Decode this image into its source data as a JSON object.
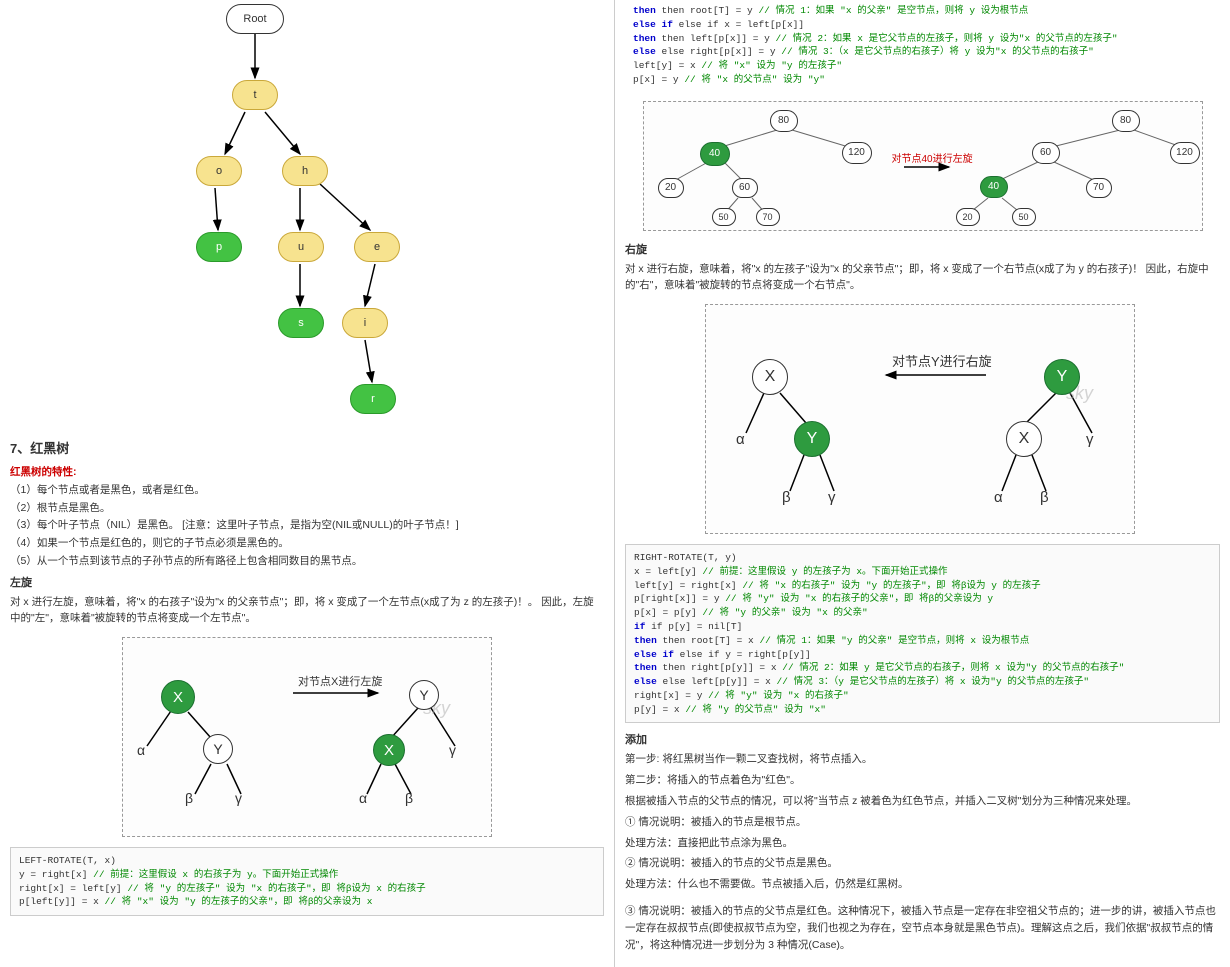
{
  "left": {
    "tree": {
      "nodes": {
        "root": "Root",
        "t": "t",
        "o": "o",
        "h": "h",
        "p": "p",
        "u": "u",
        "e": "e",
        "s": "s",
        "i": "i",
        "r": "r"
      }
    },
    "section_title": "7、红黑树",
    "props_title": "红黑树的特性:",
    "props": [
      "（1）每个节点或者是黑色，或者是红色。",
      "（2）根节点是黑色。",
      "（3）每个叶子节点（NIL）是黑色。 [注意：这里叶子节点，是指为空(NIL或NULL)的叶子节点！]",
      "（4）如果一个节点是红色的，则它的子节点必须是黑色的。",
      "（5）从一个节点到该节点的子孙节点的所有路径上包含相同数目的黑节点。"
    ],
    "left_rotate_title": "左旋",
    "left_rotate_desc": "对 x 进行左旋，意味着，将\"x 的右孩子\"设为\"x 的父亲节点\"；即，将 x 变成了一个左节点(x成了为 z 的左孩子)！。 因此，左旋中的\"左\"，意味着\"被旋转的节点将变成一个左节点\"。",
    "rotate_label": "对节点X进行左旋",
    "nodes": {
      "X": "X",
      "Y": "Y",
      "a": "α",
      "b": "β",
      "c": "γ"
    },
    "code1": {
      "l1": "LEFT-ROTATE(T, x)",
      "l2a": "y = right[x] ",
      "l2b": "// 前提：这里假设 x 的右孩子为 y。下面开始正式操作",
      "l3a": "right[x] = left[y] ",
      "l3b": "// 将 \"y 的左孩子\" 设为 \"x 的右孩子\"，即 将β设为 x 的右孩子",
      "l4a": "p[left[y]] = x ",
      "l4b": "// 将 \"x\" 设为 \"y 的左孩子的父亲\"，即 将β的父亲设为 x"
    }
  },
  "right": {
    "code_top": {
      "l1a": "then root[T] = y ",
      "l1b": "// 情况 1：如果 \"x 的父亲\" 是空节点，则将 y 设为根节点",
      "l2a": "else if x = left[p[x]]",
      "l3a": "then left[p[x]] = y ",
      "l3b": "// 情况 2：如果 x 是它父节点的左孩子，则将 y 设为\"x 的父节点的左孩子\"",
      "l4a": "else right[p[x]] = y ",
      "l4b": "// 情况 3：（x 是它父节点的右孩子）将 y 设为\"x 的父节点的右孩子\"",
      "l5a": "left[y] = x ",
      "l5b": "// 将 \"x\" 设为 \"y 的左孩子\"",
      "l6a": "p[x] = y ",
      "l6b": "// 将 \"x 的父节点\" 设为 \"y\""
    },
    "tree_nums": {
      "n80": "80",
      "n40": "40",
      "n120": "120",
      "n20": "20",
      "n60": "60",
      "n50": "50",
      "n70": "70"
    },
    "rotate40_label": "对节点40进行左旋",
    "right_rotate_title": "右旋",
    "right_rotate_desc": "对 x 进行右旋，意味着，将\"x 的左孩子\"设为\"x 的父亲节点\"；即，将 x 变成了一个右节点(x成了为 y 的右孩子)！ 因此，右旋中的\"右\"，意味着\"被旋转的节点将变成一个右节点\"。",
    "rotateY_label": "对节点Y进行右旋",
    "code2": {
      "l1": "RIGHT-ROTATE(T, y)",
      "l2a": "x = left[y] ",
      "l2b": "// 前提：这里假设 y 的左孩子为 x。下面开始正式操作",
      "l3a": "left[y] = right[x] ",
      "l3b": "// 将 \"x 的右孩子\" 设为 \"y 的左孩子\"，即 将β设为 y 的左孩子",
      "l4a": "p[right[x]] = y ",
      "l4b": "// 将 \"y\" 设为 \"x 的右孩子的父亲\"，即 将β的父亲设为 y",
      "l5a": "p[x] = p[y] ",
      "l5b": "// 将 \"y 的父亲\" 设为 \"x 的父亲\"",
      "l6a": "if p[y] = nil[T]",
      "l7a": "then root[T] = x ",
      "l7b": "// 情况 1：如果 \"y 的父亲\" 是空节点，则将 x 设为根节点",
      "l8a": "else if y = right[p[y]]",
      "l9a": "then right[p[y]] = x ",
      "l9b": "// 情况 2：如果 y 是它父节点的右孩子，则将 x 设为\"y 的父节点的右孩子\"",
      "l10a": "else left[p[y]] = x ",
      "l10b": "// 情况 3：（y 是它父节点的左孩子）将 x 设为\"y 的父节点的左孩子\"",
      "l11a": "right[x] = y ",
      "l11b": "// 将 \"y\" 设为 \"x 的右孩子\"",
      "l12a": "p[y] = x ",
      "l12b": "// 将 \"y 的父节点\" 设为 \"x\""
    },
    "add_title": "添加",
    "add_p1": "第一步: 将红黑树当作一颗二叉查找树，将节点插入。",
    "add_p2": "第二步：将插入的节点着色为\"红色\"。",
    "add_p3": "根据被插入节点的父节点的情况，可以将\"当节点 z 被着色为红色节点，并插入二叉树\"划分为三种情况来处理。",
    "add_p4": "① 情况说明：被插入的节点是根节点。",
    "add_p5": "处理方法：直接把此节点涂为黑色。",
    "add_p6": "② 情况说明：被插入的节点的父节点是黑色。",
    "add_p7": "处理方法：什么也不需要做。节点被插入后，仍然是红黑树。",
    "add_p8": "③ 情况说明：被插入的节点的父节点是红色。这种情况下，被插入节点是一定存在非空祖父节点的；进一步的讲，被插入节点也一定存在叔叔节点(即使叔叔节点为空，我们也视之为存在，空节点本身就是黑色节点)。理解这点之后，我们依据\"叔叔节点的情况\"，将这种情况进一步划分为 3 种情况(Case)。"
  }
}
